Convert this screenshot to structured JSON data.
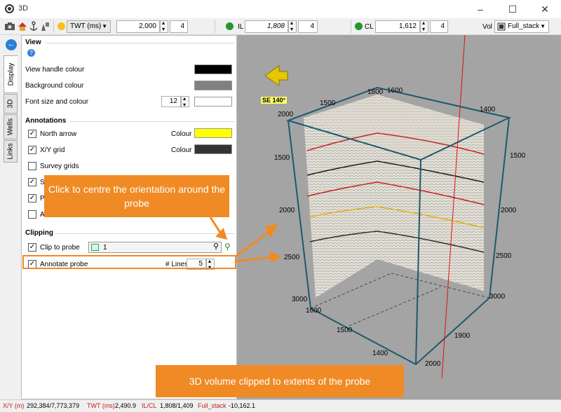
{
  "window": {
    "title": "3D"
  },
  "toolbar": {
    "domain_combo": "TWT (ms)",
    "twt_value": "2,000",
    "twt_step": "4",
    "il_label": "IL",
    "il_value": "1,808",
    "il_step": "4",
    "cl_label": "CL",
    "cl_value": "1,612",
    "cl_step": "4",
    "vol_label": "Vol",
    "vol_value": "Full_stack",
    "dot_colors": {
      "twt": "#f2c21b",
      "il": "#1f9a2e",
      "cl": "#1f9a2e"
    }
  },
  "tabs": [
    "Display",
    "3D",
    "Wells",
    "Links"
  ],
  "view": {
    "heading": "View",
    "handle_colour_label": "View handle colour",
    "handle_colour": "#000000",
    "background_colour_label": "Background colour",
    "background_colour": "#808080",
    "font_label": "Font size and colour",
    "font_size": "12",
    "font_colour": "#ffffff"
  },
  "annotations": {
    "heading": "Annotations",
    "colour_label": "Colour",
    "north_arrow_label": "North arrow",
    "north_arrow_colour": "#ffff00",
    "xy_grid_label": "X/Y grid",
    "xy_grid_colour": "#333333",
    "survey_grids_label": "Survey grids",
    "se_partial": "Se",
    "po_partial": "Po",
    "an_partial": "An"
  },
  "clipping": {
    "heading": "Clipping",
    "clip_to_probe_label": "Clip to probe",
    "probe_value": "1",
    "annotate_probe_label": "Annotate probe",
    "lines_label": "# Lines",
    "lines_value": "5"
  },
  "viewer": {
    "orientation_label": "SE 140°",
    "top_labels": [
      "1800",
      "1600"
    ],
    "left_depth_labels": [
      "2000",
      "1500",
      "2000",
      "2500",
      "3000"
    ],
    "right_labels": [
      "1400",
      "1500",
      "2000",
      "2500",
      "3000"
    ],
    "bottom_labels": [
      "1600",
      "1500",
      "1400",
      "2000",
      "1900"
    ]
  },
  "callouts": {
    "centre_probe": "Click to centre the orientation around the probe",
    "clipped_volume": "3D volume clipped to extents of the probe"
  },
  "status": {
    "xy_label": "X/Y (m)",
    "xy_value": "292,384/7,773,379",
    "twt_label": "TWT (ms)",
    "twt_value": "2,490.9",
    "ilcl_label": "IL/CL",
    "ilcl_value": "1,808/1,409",
    "vol_label": "Full_stack",
    "vol_value": "-10,162.1"
  }
}
